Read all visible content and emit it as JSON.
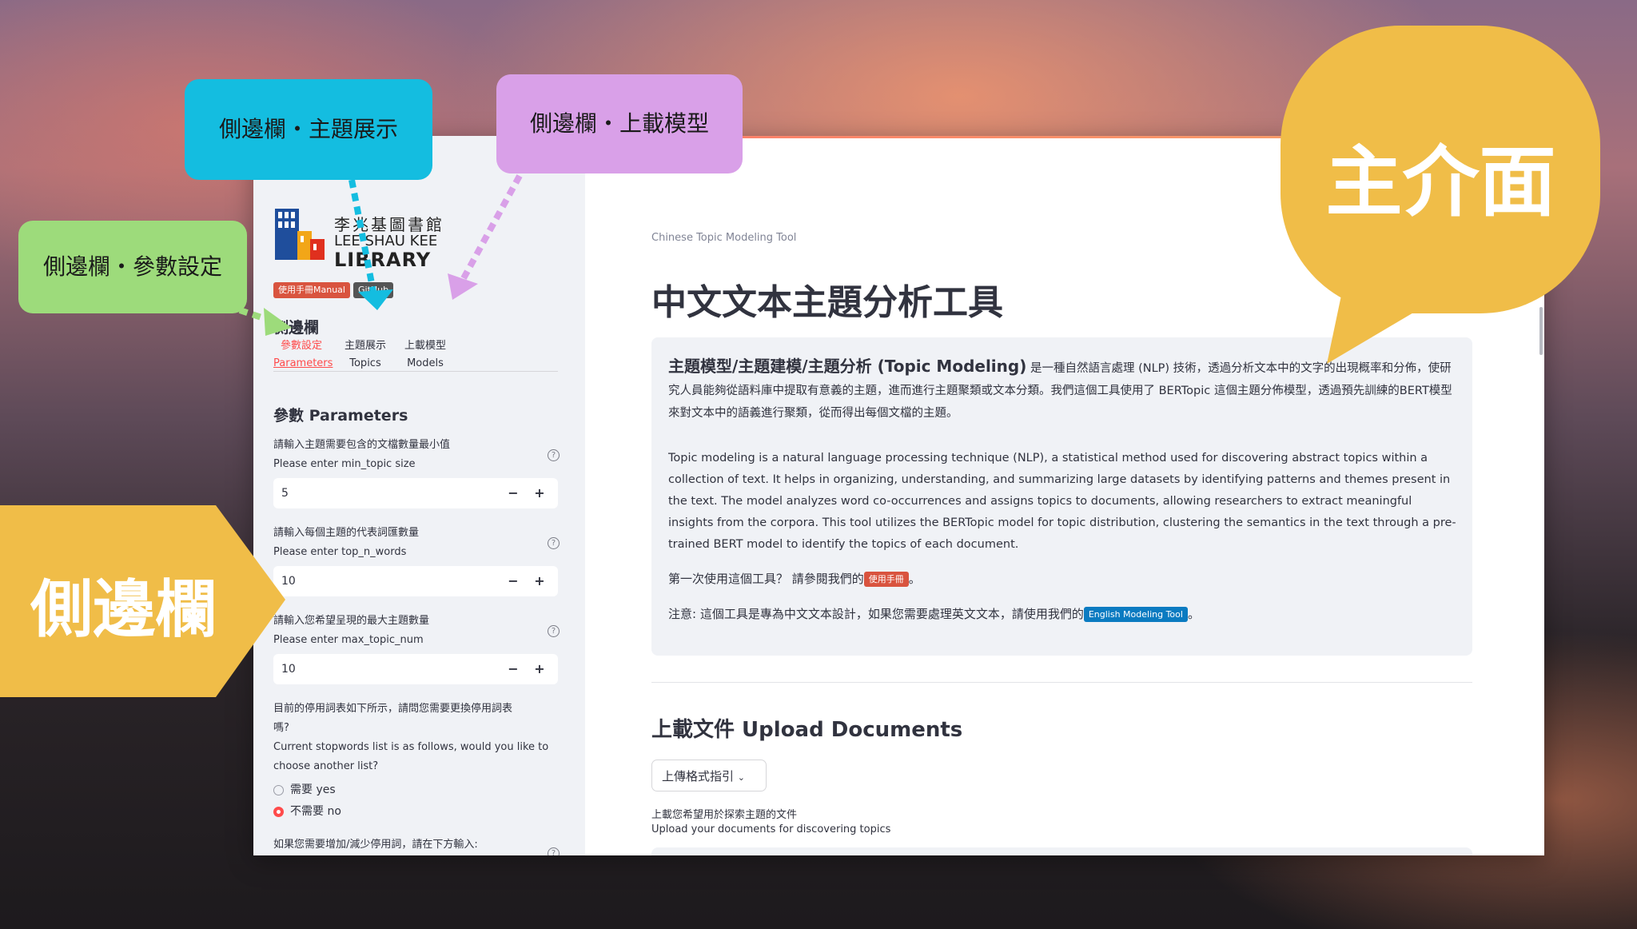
{
  "annotations": {
    "sidebar_params": "側邊欄・參數設定",
    "sidebar_topics": "側邊欄・主題展示",
    "sidebar_models": "側邊欄・上載模型",
    "main_ui": "主介面",
    "sidebar": "側邊欄",
    "colors": {
      "green": "#9ddb7b",
      "cyan": "#14bde0",
      "purple": "#d9a0e8",
      "yellow": "#f0bd48"
    }
  },
  "sidebar": {
    "logo": {
      "line1": "李兆基圖書館",
      "line2": "LEE SHAU KEE",
      "line3": "LIBRARY"
    },
    "manual_badge": "使用手冊Manual",
    "github_badge": "GitHub",
    "title": "側邊欄",
    "tabs": [
      {
        "zh": "參數設定",
        "en": "Parameters",
        "active": true
      },
      {
        "zh": "主題展示",
        "en": "Topics",
        "active": false
      },
      {
        "zh": "上載模型",
        "en": "Models",
        "active": false
      }
    ],
    "section_title": "參數 Parameters",
    "fields": [
      {
        "label_zh": "請輸入主題需要包含的文檔數量最小值",
        "label_en": "Please enter min_topic size",
        "value": "5"
      },
      {
        "label_zh": "請輸入每個主題的代表詞匯數量",
        "label_en": "Please enter top_n_words",
        "value": "10"
      },
      {
        "label_zh": "請輸入您希望呈現的最大主題數量",
        "label_en": "Please enter max_topic_num",
        "value": "10"
      }
    ],
    "stopwords_q_zh_1": "目前的停用詞表如下所示，請問您需要更換停用詞表",
    "stopwords_q_zh_2": "嗎?",
    "stopwords_q_en_1": "Current stopwords list is as follows, would you like to",
    "stopwords_q_en_2": "choose another list?",
    "radio_yes": "需要 yes",
    "radio_no": "不需要 no",
    "radio_selected": "no",
    "add_stopwords_label": "如果您需要增加/減少停用詞，請在下方輸入:"
  },
  "main": {
    "caption": "Chinese Topic Modeling Tool",
    "title": "中文文本主題分析工具",
    "intro_bold": "主題模型/主題建模/主題分析 (Topic Modeling)",
    "intro_zh": " 是一種自然語言處理 (NLP) 技術，透過分析文本中的文字的出現概率和分佈，使研究人員能夠從語料庫中提取有意義的主題，進而進行主題聚類或文本分類。我們這個工具使用了 BERTopic 這個主題分佈模型，透過預先訓練的BERT模型來對文本中的語義進行聚類，從而得出每個文檔的主題。",
    "intro_en": "Topic modeling is a natural language processing technique (NLP), a statistical method used for discovering abstract topics within a collection of text. It helps in organizing, understanding, and summarizing large datasets by identifying patterns and themes present in the text. The model analyzes word co-occurrences and assigns topics to documents, allowing researchers to extract meaningful insights from the corpora. This tool utilizes the BERTopic model for topic distribution, clustering the semantics in the text through a pre-trained BERT model to identify the topics of each document.",
    "first_time_prefix": "第一次使用這個工具？ 請參閱我們的",
    "first_time_badge": "使用手冊",
    "first_time_suffix": "。",
    "note_prefix": "注意: 這個工具是專為中文文本設計，如果您需要處理英文文本，請使用我們的",
    "note_badge": "English Modeling Tool",
    "note_suffix": "。",
    "upload_title": "上載文件 Upload Documents",
    "expander_label": "上傳格式指引",
    "upload_label_zh": "上載您希望用於探索主題的文件",
    "upload_label_en": "Upload your documents for discovering topics"
  }
}
